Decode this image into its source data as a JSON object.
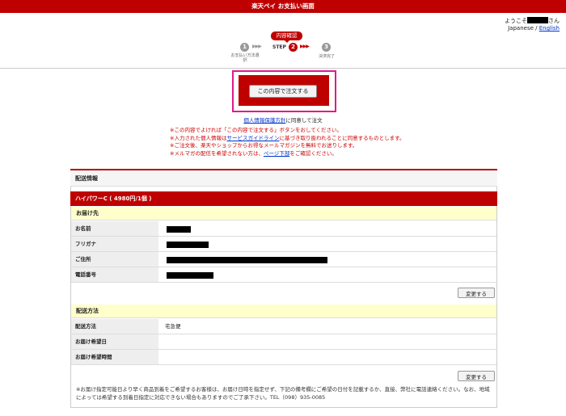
{
  "header": {
    "title": "楽天ペイ お支払い画面"
  },
  "user": {
    "greeting_prefix": "ようこそ",
    "greeting_suffix": "さん",
    "lang_current": "Japanese",
    "lang_sep": " / ",
    "lang_link": "English"
  },
  "steps": {
    "badge": "内容確認",
    "step1_num": "1",
    "step1_label": "お支払い方法選択",
    "step_label": "STEP",
    "step2_num": "2",
    "step3_num": "3",
    "step3_label": "決済完了",
    "arrows": "▶▶▶ ",
    "arrows2": "▶▶▶"
  },
  "order": {
    "button_label": "この内容で注文する"
  },
  "agree": {
    "link": "個人情報保護方針",
    "text": "に同意して注文"
  },
  "notes": {
    "line1": "※この内容でよければ「この内容で注文する」ボタンをおしてください。",
    "line2_pre": "※入力された個人情報は",
    "line2_link": "サービスガイドライン",
    "line2_post": "に基づき取り扱われることに同意するものとします。",
    "line3": "※ご注文後、楽天やショップからお得なメールマガジンを無料でお送りします。",
    "line4_pre": "※メルマガの配信を希望されない方は、",
    "line4_link": "ページ下部",
    "line4_post": "をご確認ください。"
  },
  "shipping": {
    "section_title": "配送情報",
    "product": "ハイパワーC ( 4980円/1個 )",
    "recipient_head": "お届け先",
    "fields": {
      "name": "お名前",
      "kana": "フリガナ",
      "address": "ご住所",
      "phone": "電話番号"
    },
    "change_label": "変更する",
    "method_head": "配送方法",
    "method_label": "配送方法",
    "method_value": "宅急便",
    "date_label": "お届け希望日",
    "time_label": "お届け希望時間",
    "footnote": "※お届け指定可能日より早く商品到着をご希望するお客様は、お届け日時を指定せず、下記の備考欄にご希望の日付を記載するか、直接、弊社に電話連絡ください。なお、地域によっては希望する到着日指定に対応できない場合もありますのでご了承下さい。TEL（098）935-0085"
  }
}
